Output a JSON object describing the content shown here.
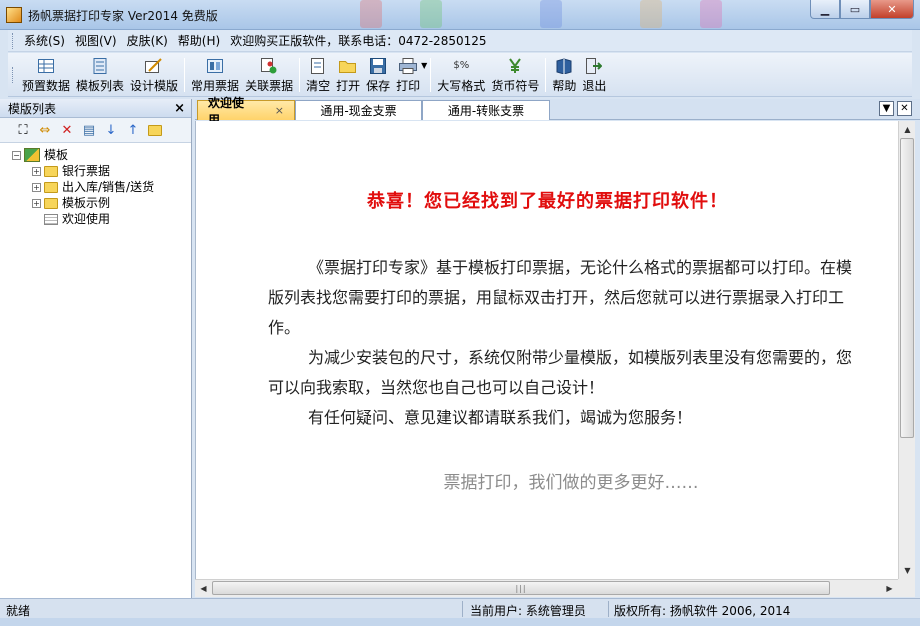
{
  "window": {
    "title": "扬帆票据打印专家 Ver2014 免费版",
    "buttons": [
      "minimize",
      "maximize",
      "close"
    ]
  },
  "menu": {
    "items": [
      "系统(S)",
      "视图(V)",
      "皮肤(K)",
      "帮助(H)",
      "欢迎购买正版软件，联系电话：0472-2850125"
    ]
  },
  "toolbar": {
    "buttons": [
      {
        "label": "预置数据",
        "icon": "table-icon"
      },
      {
        "label": "模板列表",
        "icon": "list-icon"
      },
      {
        "label": "设计模版",
        "icon": "design-icon"
      },
      {
        "label": "常用票据",
        "icon": "ticket-icon"
      },
      {
        "label": "关联票据",
        "icon": "link-ticket-icon"
      },
      {
        "label": "清空",
        "icon": "clear-icon"
      },
      {
        "label": "打开",
        "icon": "open-folder-icon"
      },
      {
        "label": "保存",
        "icon": "save-icon"
      },
      {
        "label": "打印",
        "icon": "printer-icon"
      },
      {
        "label": "大写格式",
        "icon": "percent-format-icon"
      },
      {
        "label": "货币符号",
        "icon": "currency-icon"
      },
      {
        "label": "帮助",
        "icon": "help-book-icon"
      },
      {
        "label": "退出",
        "icon": "exit-icon"
      }
    ],
    "percent_glyph": "$%"
  },
  "left_panel": {
    "title": "模版列表",
    "close": "×",
    "tree": {
      "root": "模板",
      "children": [
        "银行票据",
        "出入库/销售/送货",
        "模板示例",
        "欢迎使用"
      ]
    }
  },
  "tabs": [
    {
      "label": "欢迎使用",
      "active": true,
      "close": "×"
    },
    {
      "label": "通用-现金支票",
      "active": false
    },
    {
      "label": "通用-转账支票",
      "active": false
    }
  ],
  "content": {
    "headline": "恭喜！您已经找到了最好的票据打印软件！",
    "paragraphs": [
      "《票据打印专家》基于模板打印票据，无论什么格式的票据都可以打印。在模版列表找您需要打印的票据，用鼠标双击打开，然后您就可以进行票据录入打印工作。",
      "为减少安装包的尺寸，系统仅附带少量模版，如模版列表里没有您需要的，您可以向我索取，当然您也自己也可以自己设计！",
      "有任何疑问、意见建议都请联系我们，竭诚为您服务！"
    ],
    "slogan": "票据打印，我们做的更多更好……"
  },
  "status": {
    "ready": "就绪",
    "user": "当前用户: 系统管理员",
    "copyright": "版权所有: 扬帆软件 2006, 2014"
  },
  "colors": {
    "headline": "#e10d0d",
    "active_tab": "#ffd36a",
    "slogan": "#8c8c8c"
  }
}
